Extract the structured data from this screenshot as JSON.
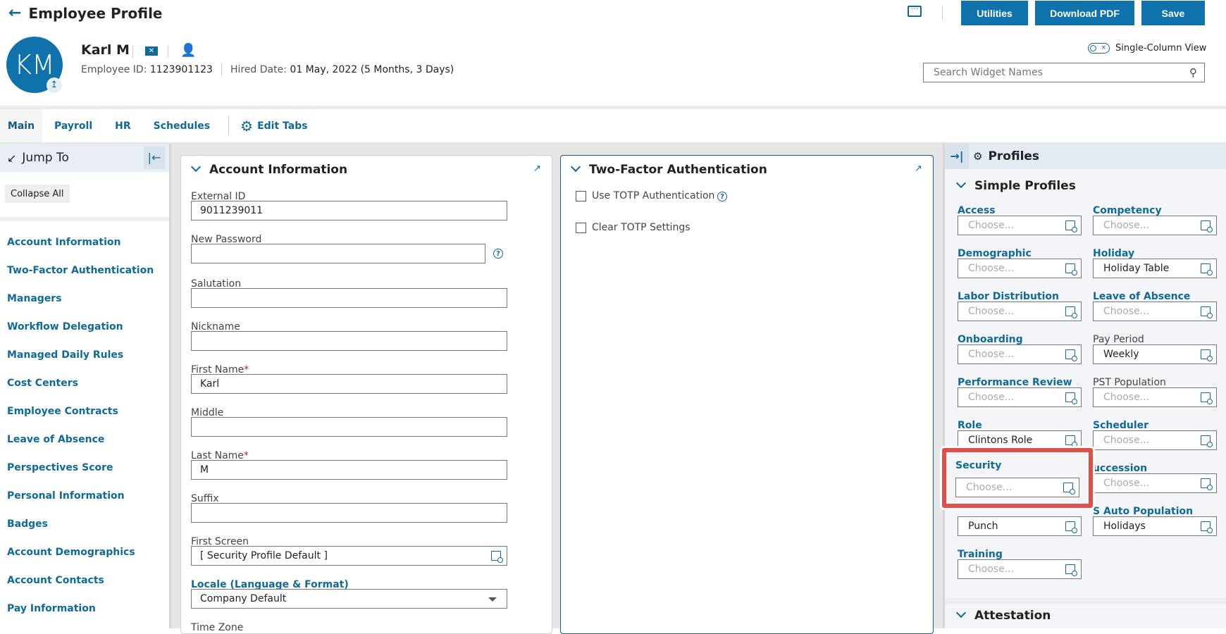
{
  "header": {
    "title": "Employee Profile",
    "buttons": {
      "utilities": "Utilities",
      "download_pdf": "Download PDF",
      "save": "Save"
    }
  },
  "employee": {
    "initials": "KM",
    "name": "Karl M",
    "id_label": "Employee ID:",
    "id_value": "1123901123",
    "hired_label": "Hired Date:",
    "hired_value": "01 May, 2022 (5 Months, 3 Days)"
  },
  "view_toggle": {
    "label": "Single-Column View",
    "on": false
  },
  "search": {
    "placeholder": "Search Widget Names",
    "value": ""
  },
  "tabs": [
    {
      "label": "Main",
      "active": true
    },
    {
      "label": "Payroll"
    },
    {
      "label": "HR"
    },
    {
      "label": "Schedules"
    }
  ],
  "edit_tabs": "Edit Tabs",
  "sidebar": {
    "title": "Jump To",
    "collapse_all": "Collapse All",
    "items": [
      "Account Information",
      "Two-Factor Authentication",
      "Managers",
      "Workflow Delegation",
      "Managed Daily Rules",
      "Cost Centers",
      "Employee Contracts",
      "Leave of Absence",
      "Perspectives Score",
      "Personal Information",
      "Badges",
      "Account Demographics",
      "Account Contacts",
      "Pay Information"
    ]
  },
  "account_info": {
    "title": "Account Information",
    "fields": [
      {
        "label": "External ID",
        "value": "9011239011"
      },
      {
        "label": "New Password",
        "value": ""
      },
      {
        "label": "Salutation",
        "value": ""
      },
      {
        "label": "Nickname",
        "value": ""
      },
      {
        "label": "First Name",
        "required": true,
        "value": "Karl"
      },
      {
        "label": "Middle",
        "value": ""
      },
      {
        "label": "Last Name",
        "required": true,
        "value": "M"
      },
      {
        "label": "Suffix",
        "value": ""
      },
      {
        "label": "First Screen",
        "value": "[ Security Profile Default ]"
      },
      {
        "label": "Locale (Language & Format)",
        "value": "Company Default"
      },
      {
        "label": "Time Zone"
      }
    ],
    "required_mark": "*"
  },
  "two_factor": {
    "title": "Two-Factor Authentication",
    "use_totp": "Use TOTP Authentication",
    "clear_totp": "Clear TOTP Settings"
  },
  "profiles": {
    "title": "Profiles",
    "section": "Simple Profiles",
    "placeholder": "Choose...",
    "items": [
      {
        "label": "Access",
        "value": ""
      },
      {
        "label": "Competency",
        "value": ""
      },
      {
        "label": "Demographic",
        "value": ""
      },
      {
        "label": "Holiday",
        "value": "Holiday Table"
      },
      {
        "label": "Labor Distribution",
        "value": ""
      },
      {
        "label": "Leave of Absence",
        "value": ""
      },
      {
        "label": "Onboarding",
        "value": ""
      },
      {
        "label": "Pay Period",
        "value": "Weekly"
      },
      {
        "label": "Performance Review",
        "value": ""
      },
      {
        "label": "PST Population",
        "value": ""
      },
      {
        "label": "Role",
        "value": "Clintons Role"
      },
      {
        "label": "Scheduler",
        "value": ""
      },
      {
        "label": "Security",
        "value": ""
      },
      {
        "label": "uccession",
        "value": ""
      },
      {
        "label": "",
        "value": "Punch"
      },
      {
        "label": "S Auto Population",
        "value": "Holidays"
      },
      {
        "label": "Training",
        "value": ""
      }
    ],
    "next_section": "Attestation"
  },
  "colors": {
    "accent": "#0f72aa",
    "highlight": "#e0504a"
  }
}
